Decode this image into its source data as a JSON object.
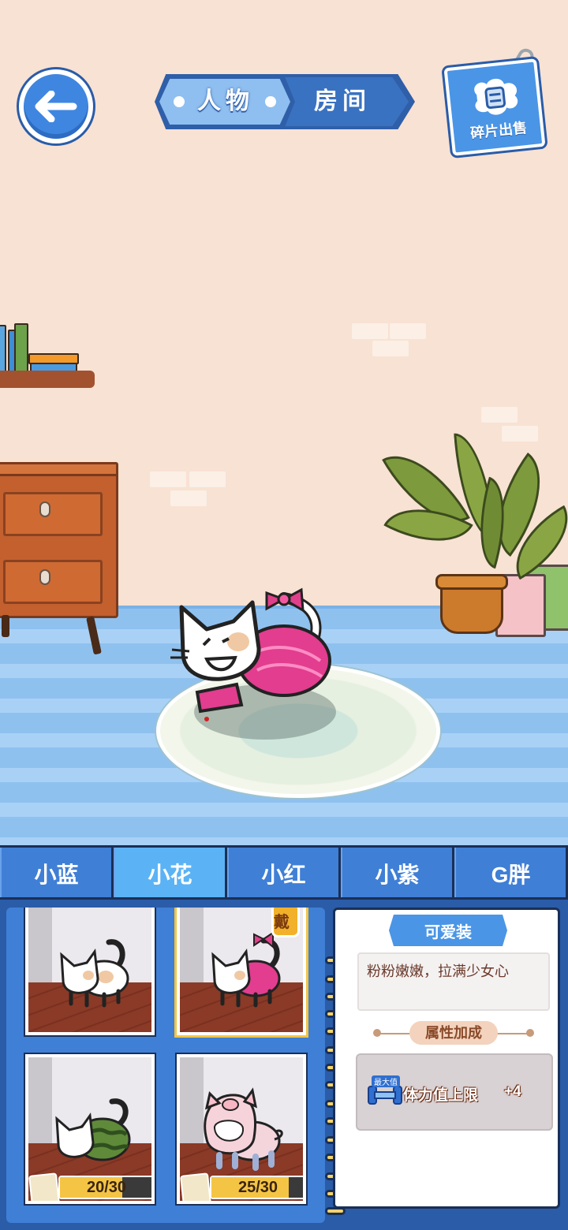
{
  "header": {
    "back_icon": "arrow-left-icon",
    "tabs": [
      {
        "label": "人物",
        "active": true
      },
      {
        "label": "房间",
        "active": false
      }
    ],
    "sell_button": {
      "label": "碎片出售",
      "icon": "fragment-icon"
    }
  },
  "characters": {
    "tabs": [
      {
        "label": "小蓝",
        "active": false
      },
      {
        "label": "小花",
        "active": true
      },
      {
        "label": "小红",
        "active": false
      },
      {
        "label": "小紫",
        "active": false
      },
      {
        "label": "G胖",
        "active": false
      }
    ]
  },
  "outfits": [
    {
      "name": "default",
      "selected": false,
      "worn": false
    },
    {
      "name": "cute",
      "selected": true,
      "worn": true,
      "worn_label": "穿戴"
    },
    {
      "name": "watermelon",
      "selected": false,
      "worn": false,
      "progress_text": "20/30",
      "progress": 0.667
    },
    {
      "name": "piggy",
      "selected": false,
      "worn": false,
      "progress_text": "25/30",
      "progress": 0.833
    }
  ],
  "detail": {
    "outfit_name": "可爱装",
    "description": "粉粉嫩嫩，拉满少女心",
    "attr_title": "属性加成",
    "stat": {
      "tag": "最大值",
      "name": "体力值上限",
      "value": "+4",
      "icon": "dumbbell-icon"
    }
  },
  "colors": {
    "primary": "#3f7fd6",
    "active_tab": "#5bb3f5",
    "panel": "#2a5ca8",
    "wall": "#f8e2d3",
    "progress": "#f4c545"
  }
}
